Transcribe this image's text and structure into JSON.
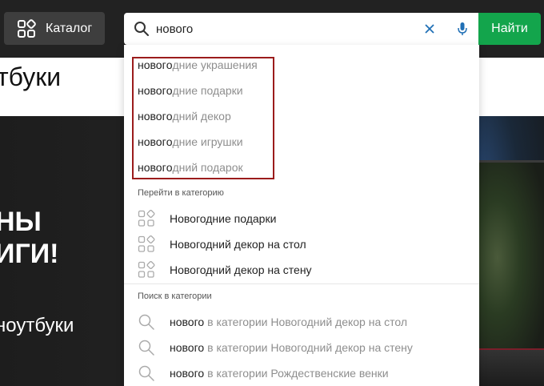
{
  "header": {
    "catalog_label": "Каталог",
    "search_value": "нового",
    "search_placeholder": "",
    "find_label": "Найти"
  },
  "page": {
    "title": "тбуки",
    "banner_line1": "НЫ",
    "banner_line2": "ИГИ!",
    "banner_sub": "ноутбуки"
  },
  "suggestions": [
    {
      "typed": "новогo",
      "rest": "дние украшения"
    },
    {
      "typed": "новогo",
      "rest": "дние подарки"
    },
    {
      "typed": "новогo",
      "rest": "дний декор"
    },
    {
      "typed": "новогo",
      "rest": "дние игрушки"
    },
    {
      "typed": "новогo",
      "rest": "дний подарок"
    }
  ],
  "categories_section": {
    "label": "Перейти в категорию",
    "items": [
      "Новогодние подарки",
      "Новогодний декор на стол",
      "Новогодний декор на стену"
    ]
  },
  "search_in_section": {
    "label": "Поиск в категории",
    "items": [
      {
        "typed": "нового",
        "rest": "в категории Новогодний декор на стол"
      },
      {
        "typed": "нового",
        "rest": "в категории Новогодний декор на стену"
      },
      {
        "typed": "нового",
        "rest": "в категории Рождественские венки"
      }
    ]
  },
  "colors": {
    "header_bg": "#222222",
    "find_button": "#13a54c",
    "highlight_border": "#9b1c1c",
    "suggestion_rest": "#8e8e8e"
  },
  "icons": [
    "catalog-grid-icon",
    "search-icon",
    "clear-icon",
    "mic-icon",
    "category-grid-icon"
  ]
}
